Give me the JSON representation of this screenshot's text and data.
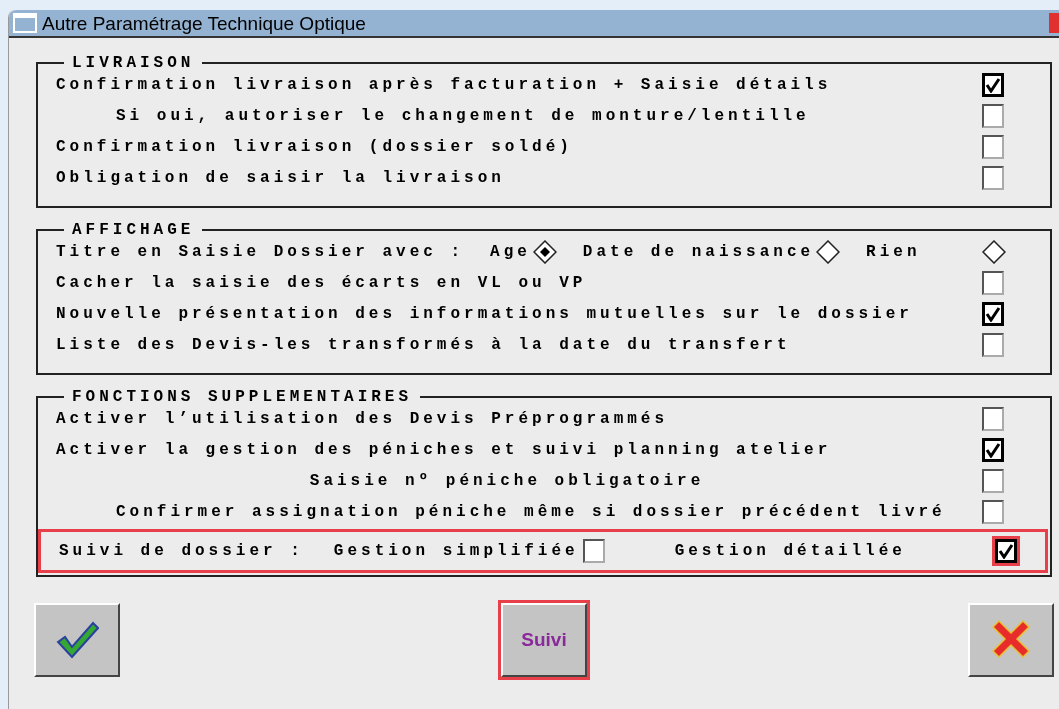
{
  "window": {
    "title": "Autre Paramétrage Technique Optique"
  },
  "sections": [
    {
      "title": "LIVRAISON",
      "rows": [
        {
          "kind": "checkbox",
          "label": "Confirmation livraison après facturation + Saisie détails",
          "checked": true,
          "children": [
            {
              "kind": "checkbox",
              "label": "Si oui, autoriser le changement de monture/lentille",
              "checked": false,
              "centered": false
            }
          ]
        },
        {
          "kind": "checkbox",
          "label": "Confirmation livraison (dossier soldé)",
          "checked": false
        },
        {
          "kind": "checkbox",
          "label": "Obligation de saisir la livraison",
          "checked": false
        }
      ]
    },
    {
      "title": "AFFICHAGE",
      "rows": [
        {
          "kind": "radio",
          "label": "Titre en Saisie Dossier avec :",
          "options": [
            {
              "label": "Age",
              "selected": true
            },
            {
              "label": "Date de naissance",
              "selected": false
            },
            {
              "label": "Rien",
              "selected": false
            }
          ]
        },
        {
          "kind": "checkbox",
          "label": "Cacher la saisie des écarts en VL ou VP",
          "checked": false
        },
        {
          "kind": "checkbox",
          "label": "Nouvelle présentation des informations mutuelles sur le dossier",
          "checked": true
        },
        {
          "kind": "checkbox",
          "label": "Liste des Devis-les transformés à la date du transfert",
          "checked": false
        }
      ]
    },
    {
      "title": "FONCTIONS SUPPLEMENTAIRES",
      "rows": [
        {
          "kind": "checkbox",
          "label": "Activer l’utilisation des Devis Préprogrammés",
          "checked": false
        },
        {
          "kind": "checkbox",
          "label": "Activer la gestion des péniches et suivi planning atelier",
          "checked": true,
          "children": [
            {
              "kind": "checkbox",
              "label": "Saisie nº péniche obligatoire",
              "checked": false,
              "centered": true
            },
            {
              "kind": "checkbox",
              "label": "Confirmer assignation péniche même si dossier précédent livré",
              "checked": false,
              "centered": false
            }
          ]
        },
        {
          "kind": "choice",
          "label": "Suivi de dossier :",
          "highlighted": true,
          "options": [
            {
              "label": "Gestion simplifiée",
              "checked": false,
              "highlighted": false
            },
            {
              "label": "Gestion détaillée",
              "checked": true,
              "highlighted": true
            }
          ]
        }
      ]
    }
  ],
  "buttons": [
    {
      "kind": "ok",
      "highlighted": false
    },
    {
      "kind": "text",
      "label": "Suivi",
      "highlighted": true
    },
    {
      "kind": "cancel",
      "highlighted": false
    }
  ]
}
